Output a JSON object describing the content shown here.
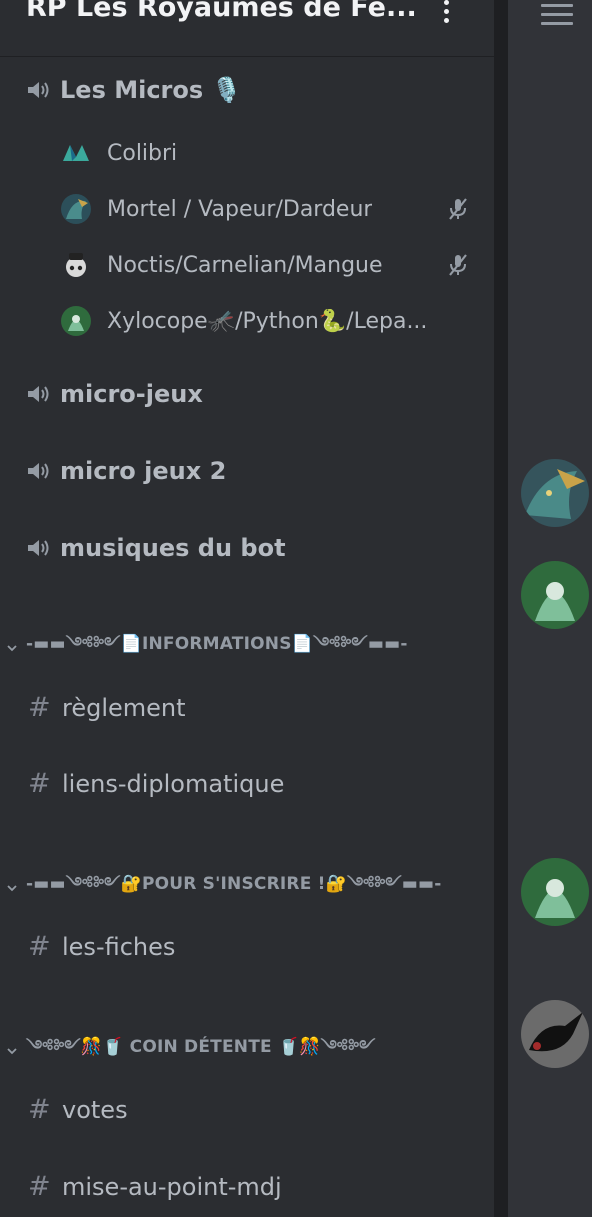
{
  "server": {
    "title": "RP Les Royaumes de Fe..."
  },
  "voice_category": {
    "name": "Les Micros 🎙️",
    "users": [
      {
        "name": "Colibri",
        "muted": false
      },
      {
        "name": "Mortel / Vapeur/Dardeur",
        "muted": true
      },
      {
        "name": "Noctis/Carnelian/Mangue",
        "muted": true
      },
      {
        "name": "Xylocope🦟/Python🐍/Lepa...",
        "muted": false
      }
    ]
  },
  "voice_channels": [
    {
      "name": "micro-jeux"
    },
    {
      "name": "micro jeux 2"
    },
    {
      "name": "musiques du bot"
    }
  ],
  "categories": [
    {
      "name": "-▬▬༺༻📄INFORMATIONS📄༺༻▬▬-",
      "channels": [
        "règlement",
        "liens-diplomatique"
      ]
    },
    {
      "name": "-▬▬༺༻🔐POUR S'INSCRIRE !🔐༺༻▬▬-",
      "channels": [
        "les-fiches"
      ]
    },
    {
      "name": "༺༻🎊🥤 COIN DÉTENTE 🥤🎊༺༻",
      "channels": [
        "votes",
        "mise-au-point-mdj"
      ]
    }
  ],
  "colors": {
    "background": "#2b2d31",
    "divider": "#1e1f22",
    "right_panel": "#313338",
    "title": "#f2f3f5",
    "channel_text": "#b5bac1",
    "muted_text": "#949ba4"
  },
  "icons": [
    "speaker-icon",
    "muted-microphone-icon",
    "hash-icon",
    "chevron-down-icon",
    "kebab-menu-icon",
    "hamburger-menu-icon"
  ]
}
